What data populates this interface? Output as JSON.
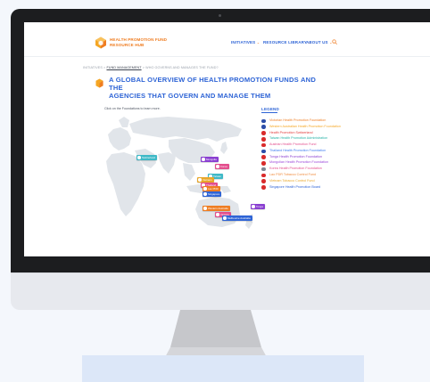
{
  "site": {
    "logo_line1": "HEALTH PROMOTION FUND",
    "logo_line2": "RESOURCE HUB"
  },
  "nav": {
    "items": [
      {
        "label": "INITIATIVES"
      },
      {
        "label": "RESOURCE LIBRARY"
      },
      {
        "label": "ABOUT US"
      }
    ]
  },
  "breadcrumb": {
    "first": "INITIATIVES",
    "sep1": " > ",
    "current": "FUND MANAGEMENT",
    "sep2": " > ",
    "last": "WHO GOVERNS AND MANAGES THE FUND?"
  },
  "page": {
    "title_line1": "A GLOBAL OVERVIEW OF HEALTH PROMOTION FUNDS AND THE",
    "title_line2": "AGENCIES THAT GOVERN AND MANAGE THEM",
    "instruction": "Click on the Foundations to learn more."
  },
  "map": {
    "markers": [
      {
        "label": "Switzerland",
        "color": "#3fb9c7"
      },
      {
        "label": "Mongolia",
        "color": "#8a3fd1"
      },
      {
        "label": "Korea",
        "color": "#e34e8d"
      },
      {
        "label": "Taiwan",
        "color": "#3fb9c7"
      },
      {
        "label": "Vietnam",
        "color": "#e9a72a"
      },
      {
        "label": "Thailand",
        "color": "#e34e8d"
      },
      {
        "label": "Lao PDR",
        "color": "#ef7d22"
      },
      {
        "label": "Singapore",
        "color": "#2e64d6"
      },
      {
        "label": "Tonga",
        "color": "#8a3fd1"
      },
      {
        "label": "Western Australia",
        "color": "#ef7d22"
      },
      {
        "label": "Victoria",
        "color": "#e34e8d"
      },
      {
        "label": "Melbourne Australia",
        "color": "#2e64d6"
      }
    ],
    "zoom_in": "+",
    "zoom_out": "−"
  },
  "legend": {
    "title": "LEGEND",
    "items": [
      {
        "label": "Victorian Health Promotion Foundation",
        "color": "#ef7d22",
        "flag": "#2c4ea8"
      },
      {
        "label": "Western Australian Health Promotion Foundation",
        "color": "#f5a623",
        "flag": "#2c4ea8"
      },
      {
        "label": "Health Promotion Switzerland",
        "color": "#e33b3b",
        "flag": "#d92b2b"
      },
      {
        "label": "Taiwan Health Promotion Administration",
        "color": "#27b3a6",
        "flag": "#d92b2b"
      },
      {
        "label": "Austrian Health Promotion Fund",
        "color": "#e34e8d",
        "flag": "#d92b2b"
      },
      {
        "label": "Thailand Health Promotion Foundation",
        "color": "#3d7cf0",
        "flag": "#2c4ea8"
      },
      {
        "label": "Tonga Health Promotion Foundation",
        "color": "#8a3fd1",
        "flag": "#d92b2b"
      },
      {
        "label": "Mongolian Health Promotion Foundation",
        "color": "#9b46d9",
        "flag": "#d92b2b"
      },
      {
        "label": "Korea Health Promotion Foundation",
        "color": "#e34e8d",
        "flag": "#7d8594"
      },
      {
        "label": "Lao PDR Tobacco Control Fund",
        "color": "#f08b3c",
        "flag": "#d92b2b"
      },
      {
        "label": "Vietnam Tobacco Control Fund",
        "color": "#e9a72a",
        "flag": "#d92b2b"
      },
      {
        "label": "Singapore Health Promotion Board",
        "color": "#2e64d6",
        "flag": "#d92b2b"
      }
    ]
  }
}
